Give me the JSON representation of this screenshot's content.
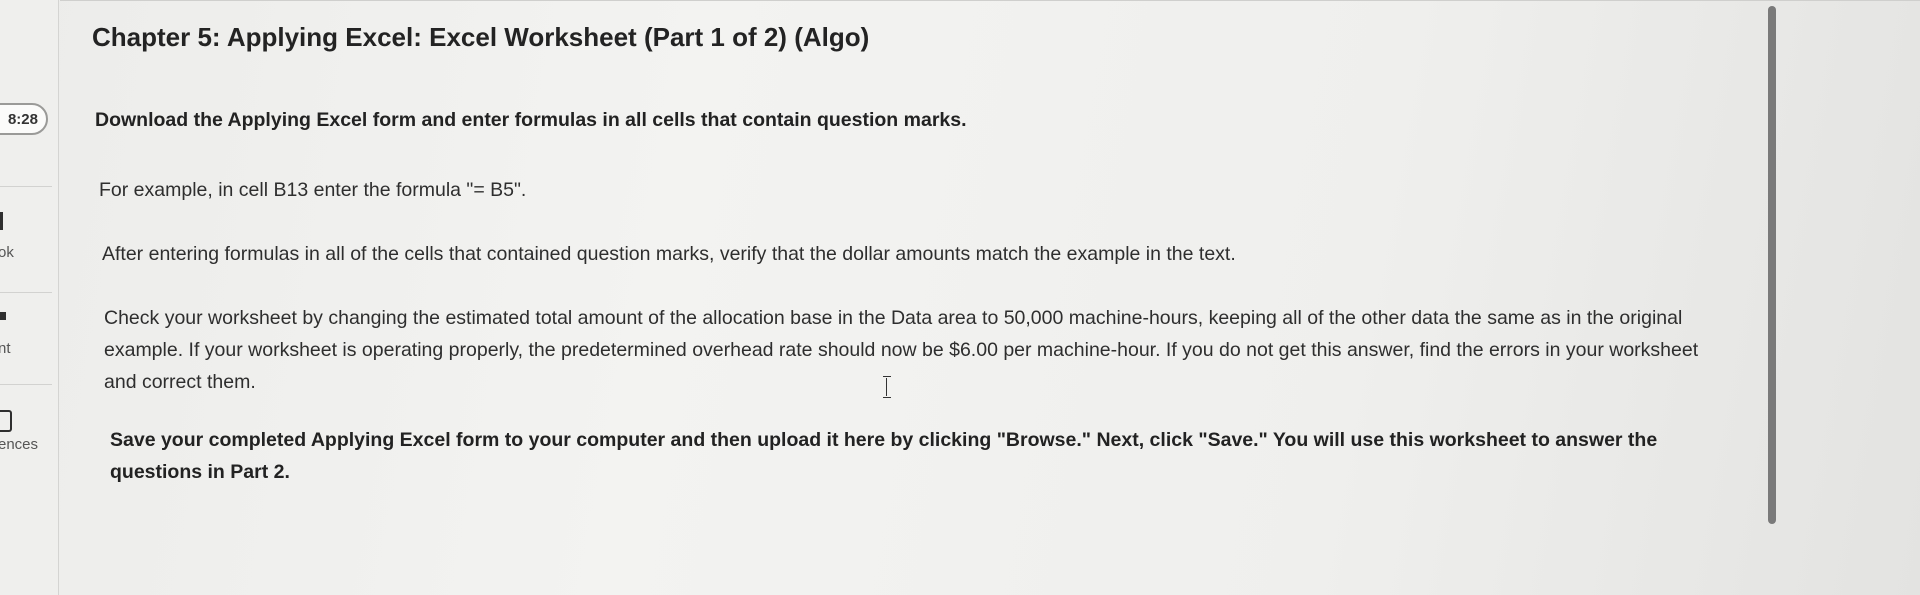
{
  "sidebar": {
    "timer": "8:28",
    "items": [
      {
        "label": "ok"
      },
      {
        "label": "nt"
      },
      {
        "label": "ences"
      }
    ]
  },
  "main": {
    "title": "Chapter 5: Applying Excel: Excel Worksheet (Part 1 of 2) (Algo)",
    "paragraphs": [
      "Download the Applying Excel form and enter formulas in all cells that contain question marks.",
      "For example, in cell B13 enter the formula \"= B5\".",
      "After entering formulas in all of the cells that contained question marks, verify that the dollar amounts match the example in the text.",
      "Check your worksheet by changing the estimated total amount of the allocation base in the Data area to 50,000 machine-hours, keeping all of the other data the same as in the original example. If your worksheet is operating properly, the predetermined overhead rate should now be $6.00 per machine-hour. If you do not get this answer, find the errors in your worksheet and correct them.",
      "Save your completed Applying Excel form to your computer and then upload it here by clicking \"Browse.\" Next, click \"Save.\" You will use this worksheet to answer the questions in Part 2."
    ]
  }
}
